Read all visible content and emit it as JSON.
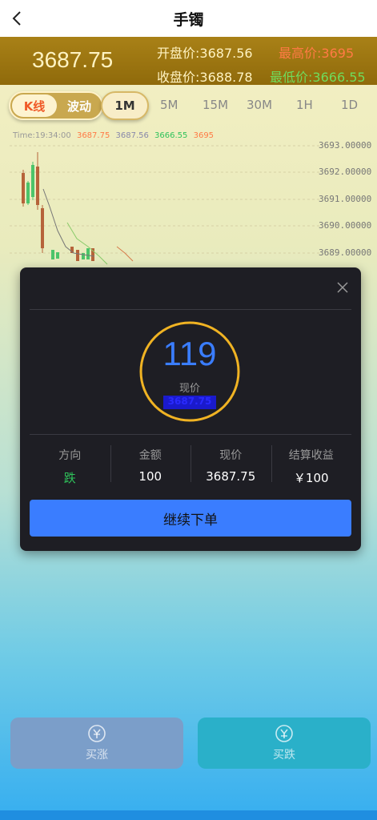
{
  "header": {
    "title": "手镯"
  },
  "price_bar": {
    "current": "3687.75",
    "open_label": "开盘价:",
    "open_value": "3687.56",
    "high_label": "最高价:",
    "high_value": "3695",
    "close_label": "收盘价:",
    "close_value": "3688.78",
    "low_label": "最低价:",
    "low_value": "3666.55"
  },
  "tabs": {
    "kline": "K线",
    "wave": "波动",
    "timeframes": [
      "1M",
      "5M",
      "15M",
      "30M",
      "1H",
      "1D"
    ],
    "active": "1M"
  },
  "chart": {
    "info_time": "Time:19:34:00",
    "info_values": [
      "3687.75",
      "3687.56",
      "3666.55",
      "3695"
    ],
    "y_ticks": [
      "3693.00000",
      "3692.00000",
      "3691.00000",
      "3690.00000",
      "3689.00000"
    ]
  },
  "modal": {
    "countdown": "119",
    "current_label": "现价",
    "current_value": "3687.75",
    "direction_label": "方向",
    "direction_value": "跌",
    "amount_label": "金额",
    "amount_value": "100",
    "price_label": "现价",
    "price_value": "3687.75",
    "profit_label": "结算收益",
    "profit_value": "￥100",
    "continue_label": "继续下单"
  },
  "actions": {
    "buy_up": "买涨",
    "buy_down": "买跌"
  },
  "colors": {
    "accent": "#3a7dff",
    "rise": "#ff7a45",
    "fall": "#2fc25b",
    "price_bar": "#9a740f",
    "ring": "#f0b323"
  }
}
